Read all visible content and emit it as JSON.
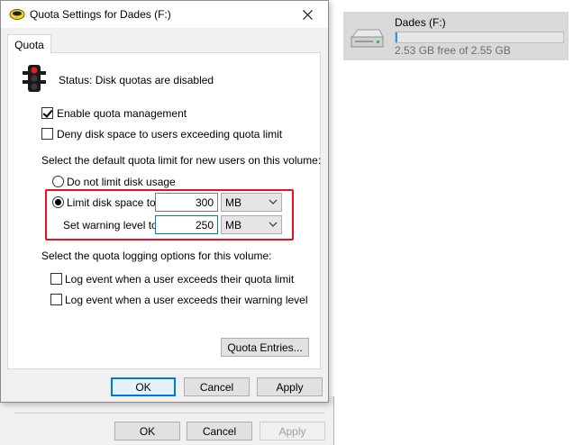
{
  "drive": {
    "name": "Dades (F:)",
    "free_text": "2.53 GB free of 2.55 GB",
    "used_fraction": 0.01,
    "icon": "hard-drive-icon"
  },
  "background_dialog": {
    "ok_label": "OK",
    "cancel_label": "Cancel",
    "apply_label": "Apply"
  },
  "dialog": {
    "title": "Quota Settings for Dades (F:)",
    "title_icon": "disk-drive-icon",
    "close_icon": "close-icon",
    "tab_label": "Quota",
    "status_icon": "traffic-light-icon",
    "status_text": "Status:  Disk quotas are disabled",
    "enable_quota": {
      "label": "Enable quota management",
      "checked": true
    },
    "deny_space": {
      "label": "Deny disk space to users exceeding quota limit",
      "checked": false
    },
    "default_limit_heading": "Select the default quota limit for new users on this volume:",
    "no_limit": {
      "label": "Do not limit disk usage",
      "selected": false
    },
    "limit_space": {
      "label": "Limit disk space to",
      "selected": true,
      "value": "300",
      "unit": "MB"
    },
    "warning_level": {
      "label": "Set warning level to",
      "value": "250",
      "unit": "MB"
    },
    "logging_heading": "Select the quota logging options for this volume:",
    "log_limit": {
      "label": "Log event when a user exceeds their quota limit",
      "checked": false
    },
    "log_warning": {
      "label": "Log event when a user exceeds their warning level",
      "checked": false
    },
    "quota_entries_label": "Quota Entries...",
    "ok_label": "OK",
    "cancel_label": "Cancel",
    "apply_label": "Apply",
    "highlight_color": "#e3141f",
    "accent_color": "#0078d7"
  }
}
